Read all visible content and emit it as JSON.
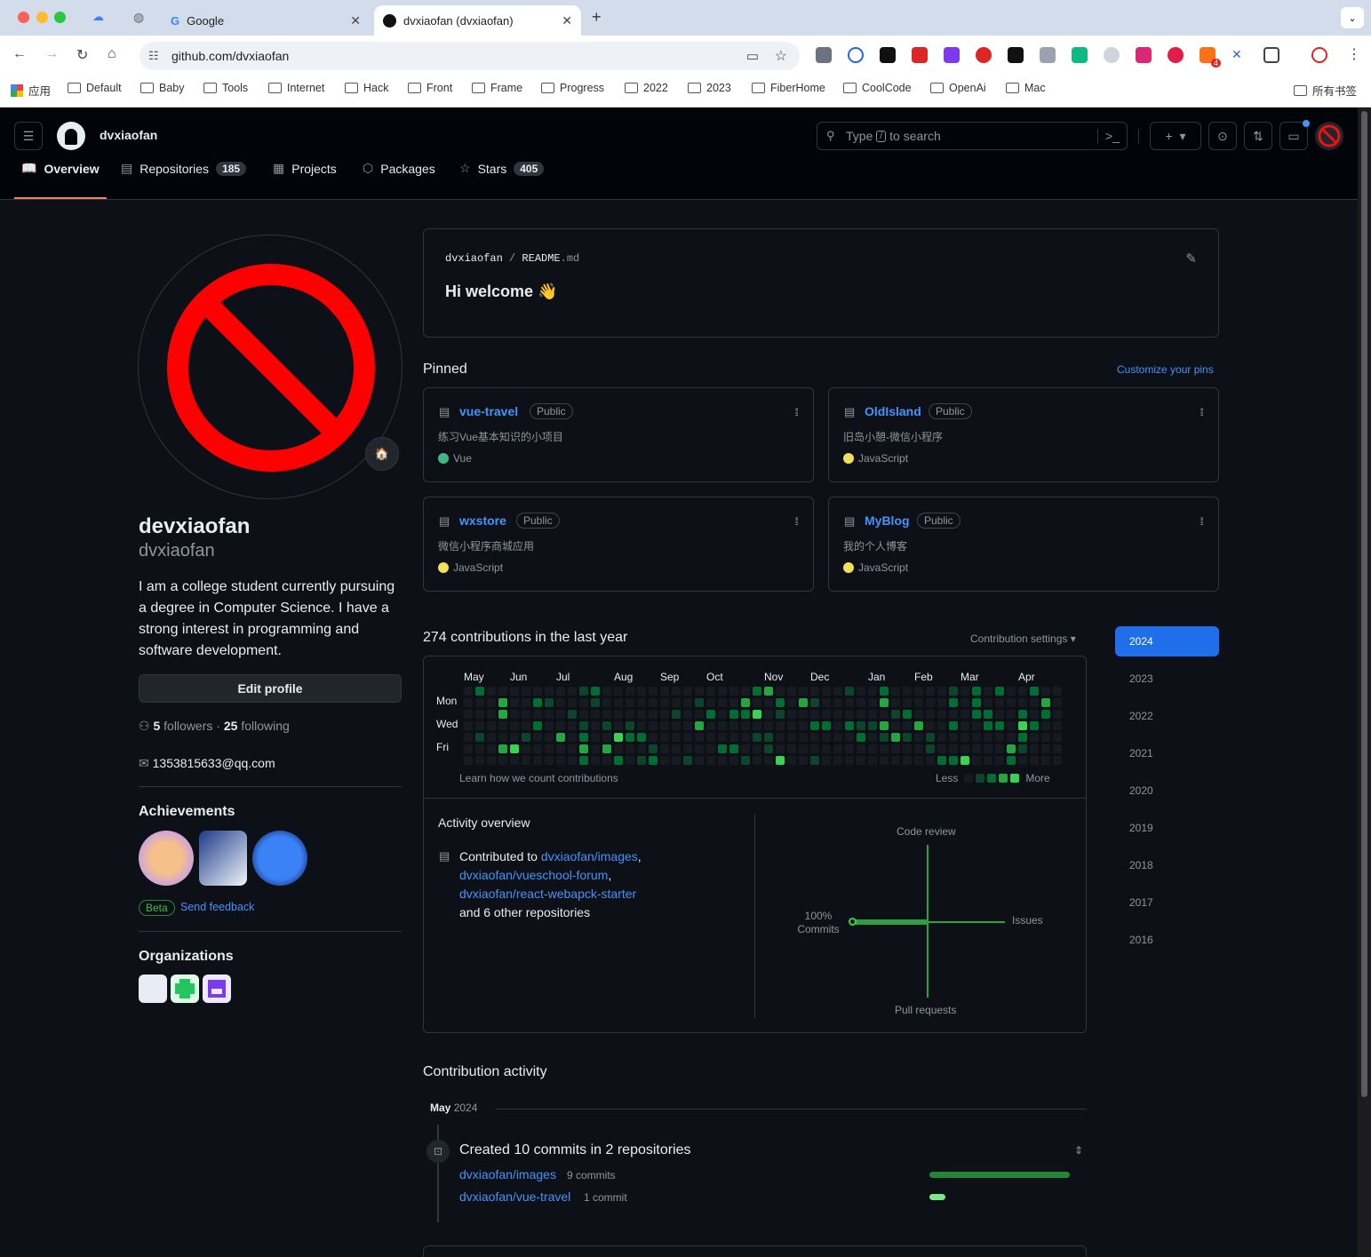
{
  "browser": {
    "tabs": [
      {
        "title": "Google"
      },
      {
        "title": "dvxiaofan (dvxiaofan)"
      }
    ],
    "url": "github.com/dvxiaofan",
    "bookmarks": [
      "应用",
      "Default",
      "Baby",
      "Tools",
      "Internet",
      "Hack",
      "Front",
      "Frame",
      "Progress",
      "2022",
      "2023",
      "FiberHome",
      "CoolCode",
      "OpenAi",
      "Mac"
    ],
    "bookmarks_right": "所有书签",
    "ext_badge": "4"
  },
  "header": {
    "username": "dvxiaofan",
    "search_pre": "Type",
    "search_key": "/",
    "search_post": "to search"
  },
  "nav": [
    {
      "label": "Overview",
      "icon": "book-icon"
    },
    {
      "label": "Repositories",
      "count": "185",
      "icon": "repo-icon"
    },
    {
      "label": "Projects",
      "icon": "table-icon"
    },
    {
      "label": "Packages",
      "icon": "package-icon"
    },
    {
      "label": "Stars",
      "count": "405",
      "icon": "star-icon"
    }
  ],
  "profile": {
    "name": "devxiaofan",
    "login": "dvxiaofan",
    "bio": "I am a college student currently pursuing a degree in Computer Science. I have a strong interest in programming and software development.",
    "edit": "Edit profile",
    "followers": "5",
    "followers_label": "followers",
    "dot": "·",
    "following": "25",
    "following_label": "following",
    "email": "1353815633@qq.com",
    "achievements_title": "Achievements",
    "beta": "Beta",
    "feedback": "Send feedback",
    "orgs_title": "Organizations",
    "status_emoji": "🏠"
  },
  "readme": {
    "owner": "dvxiaofan",
    "sep": "/",
    "file": "README",
    "ext": ".md",
    "text": "Hi welcome 👋"
  },
  "pinned": {
    "title": "Pinned",
    "customize": "Customize your pins",
    "repos": [
      {
        "name": "vue-travel",
        "vis": "Public",
        "desc": "练习Vue基本知识的小项目",
        "lang": "Vue",
        "color": "#41b883"
      },
      {
        "name": "OldIsland",
        "vis": "Public",
        "desc": "旧岛小憩-微信小程序",
        "lang": "JavaScript",
        "color": "#f1e05a"
      },
      {
        "name": "wxstore",
        "vis": "Public",
        "desc": "微信小程序商城应用",
        "lang": "JavaScript",
        "color": "#f1e05a"
      },
      {
        "name": "MyBlog",
        "vis": "Public",
        "desc": "我的个人博客",
        "lang": "JavaScript",
        "color": "#f1e05a"
      }
    ]
  },
  "contrib": {
    "title": "274 contributions in the last year",
    "settings": "Contribution settings ▾",
    "months": [
      "May",
      "Jun",
      "Jul",
      "Aug",
      "Sep",
      "Oct",
      "Nov",
      "Dec",
      "Jan",
      "Feb",
      "Mar",
      "Apr"
    ],
    "days": [
      "Mon",
      "Wed",
      "Fri"
    ],
    "learn": "Learn how we count contributions",
    "less": "Less",
    "more": "More"
  },
  "years": [
    "2024",
    "2023",
    "2022",
    "2021",
    "2020",
    "2019",
    "2018",
    "2017",
    "2016"
  ],
  "activity": {
    "title": "Activity overview",
    "contributed": "Contributed to",
    "r1": "dvxiaofan/images",
    "r2": "dvxiaofan/vueschool-forum",
    "r3": "dvxiaofan/react-webapck-starter",
    "others": "and 6 other repositories",
    "axis": {
      "top": "Code review",
      "right": "Issues",
      "bottom": "Pull requests",
      "left_pct": "100%",
      "left": "Commits"
    }
  },
  "timeline": {
    "title": "Contribution activity",
    "month": "May",
    "year": "2024",
    "created": "Created 10 commits in 2 repositories",
    "rows": [
      {
        "repo": "dvxiaofan/images",
        "count": "9 commits",
        "frac": 0.9
      },
      {
        "repo": "dvxiaofan/vue-travel",
        "count": "1 commit",
        "frac": 0.1
      }
    ]
  },
  "colors": {
    "accent": "#1f6feb",
    "link": "#4493f8",
    "green": "#39d353"
  }
}
